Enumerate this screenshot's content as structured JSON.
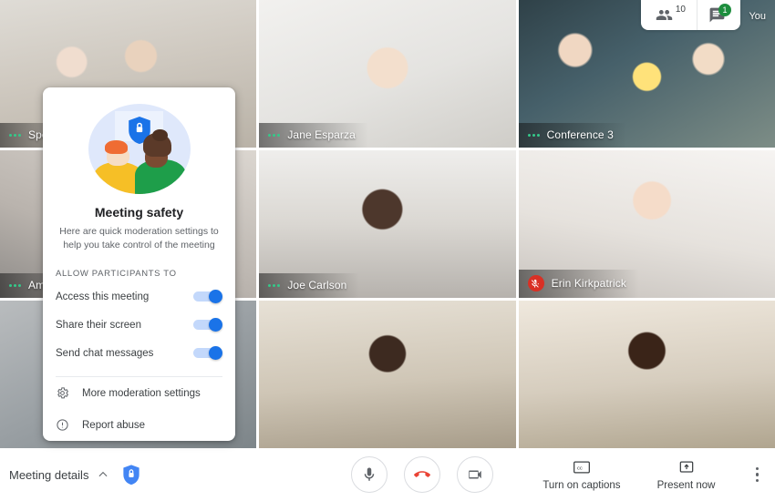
{
  "top_controls": {
    "participants": {
      "icon": "people-icon",
      "count": "10"
    },
    "chat": {
      "icon": "chat-icon",
      "badge": "1"
    },
    "self_label": "You"
  },
  "grid": {
    "tiles": [
      {
        "name": "Spencer",
        "mic": "active",
        "bg": "bg-room-a"
      },
      {
        "name": "Jane Esparza",
        "mic": "active",
        "bg": "bg-room-b"
      },
      {
        "name": "Conference 3",
        "mic": "active",
        "bg": "bg-room-c"
      },
      {
        "name": "Amy Luan",
        "mic": "active",
        "bg": "bg-room-d"
      },
      {
        "name": "Joe Carlson",
        "mic": "active",
        "bg": "bg-room-e"
      },
      {
        "name": "Erin Kirkpatrick",
        "mic": "muted",
        "bg": "bg-room-f"
      },
      {
        "name": "",
        "mic": "none",
        "bg": "bg-room-g"
      },
      {
        "name": "",
        "mic": "none",
        "bg": "bg-room-h"
      },
      {
        "name": "",
        "mic": "none",
        "bg": "bg-room-i"
      }
    ]
  },
  "safety_panel": {
    "illustration": "meeting-safety-illustration",
    "title": "Meeting safety",
    "subtitle": "Here are quick moderation settings to help you take control of the meeting",
    "section_label": "ALLOW PARTICIPANTS TO",
    "toggles": [
      {
        "label": "Access this meeting",
        "state": "on"
      },
      {
        "label": "Share their screen",
        "state": "on"
      },
      {
        "label": "Send chat messages",
        "state": "on"
      }
    ],
    "actions": [
      {
        "label": "More moderation settings",
        "icon": "gear-icon"
      },
      {
        "label": "Report abuse",
        "icon": "report-icon"
      }
    ]
  },
  "bottom_bar": {
    "meeting_details": "Meeting details",
    "shield_icon": "host-controls-shield-icon",
    "call_controls": [
      {
        "name": "microphone-button",
        "icon": "mic-icon"
      },
      {
        "name": "hang-up-button",
        "icon": "end-call-icon"
      },
      {
        "name": "camera-button",
        "icon": "video-icon"
      }
    ],
    "captions": {
      "label": "Turn on captions",
      "icon": "closed-caption-icon"
    },
    "present": {
      "label": "Present now",
      "icon": "present-icon"
    },
    "more": "more-options-icon"
  },
  "colors": {
    "accent_blue": "#1a73e8",
    "danger_red": "#ea4335",
    "badge_green": "#1e8e3e",
    "mic_active_green": "#34c98a",
    "text_primary": "#3c4043",
    "text_secondary": "#5f6368"
  }
}
